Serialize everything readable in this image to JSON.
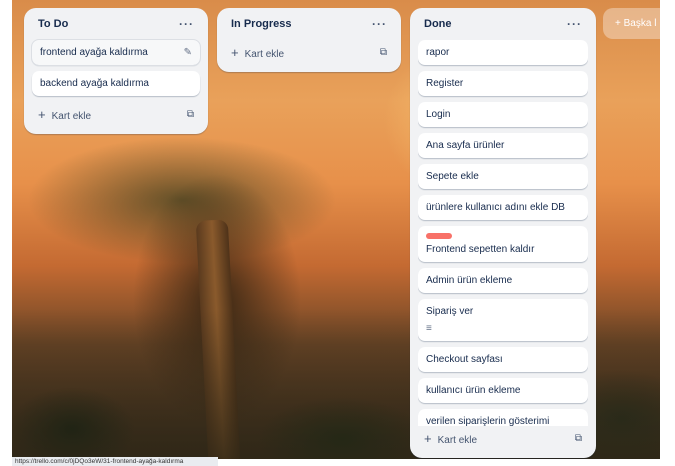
{
  "board": {
    "lists": [
      {
        "title": "To Do",
        "menu": "···",
        "cards": [
          {
            "text": "frontend ayağa kaldırma"
          },
          {
            "text": "backend ayağa kaldırma"
          }
        ],
        "add_label": "Kart ekle"
      },
      {
        "title": "In Progress",
        "menu": "···",
        "cards": [],
        "add_label": "Kart ekle"
      },
      {
        "title": "Done",
        "menu": "···",
        "cards": [
          {
            "text": "rapor"
          },
          {
            "text": "Register"
          },
          {
            "text": "Login"
          },
          {
            "text": "Ana sayfa ürünler"
          },
          {
            "text": "Sepete ekle"
          },
          {
            "text": "ürünlere kullanıcı adını ekle DB"
          },
          {
            "text": "Frontend sepetten kaldır",
            "label_color": "#f87168"
          },
          {
            "text": "Admin ürün ekleme"
          },
          {
            "text": "Sipariş ver",
            "has_description": true
          },
          {
            "text": "Checkout sayfası"
          },
          {
            "text": "kullanıcı ürün ekleme"
          },
          {
            "text": "verilen siparişlerin gösterimi backend"
          }
        ],
        "add_label": "Kart ekle"
      }
    ],
    "add_list_label": "+ Başka l"
  },
  "status_url": "https://trello.com/c/0jDQo3eW/31-frontend-ayağa-kaldırma",
  "icons": {
    "plus": "+",
    "edit": "✎",
    "template": "⧉",
    "description": "≡"
  }
}
